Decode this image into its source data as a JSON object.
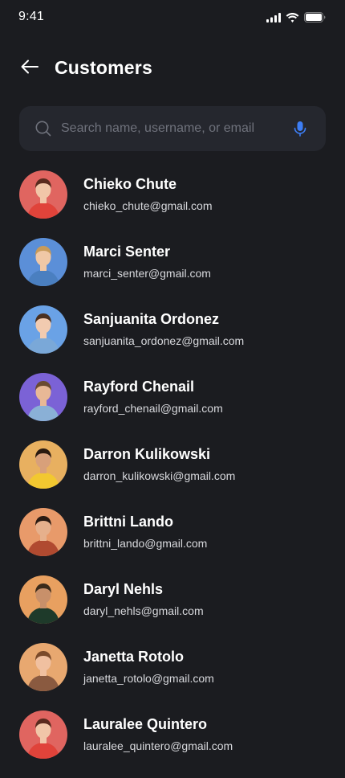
{
  "status_bar": {
    "time": "9:41"
  },
  "header": {
    "back_icon": "arrow-left-icon",
    "title": "Customers"
  },
  "search": {
    "placeholder": "Search name, username, or email",
    "value": "",
    "search_icon": "search-icon",
    "mic_icon": "microphone-icon",
    "mic_color": "#3d7ef5"
  },
  "colors": {
    "background": "#1b1c20",
    "search_bg": "#25272e",
    "accent": "#3d7ef5"
  },
  "customers": [
    {
      "name": "Chieko Chute",
      "email": "chieko_chute@gmail.com",
      "avatar_bg": "#e06560",
      "shirt": "#e0433a",
      "hair": "#5a2a1e",
      "skin": "#f1c6a8"
    },
    {
      "name": "Marci Senter",
      "email": "marci_senter@gmail.com",
      "avatar_bg": "#5b8fd8",
      "shirt": "#4a7fc0",
      "hair": "#c89b5a",
      "skin": "#f0c8a6"
    },
    {
      "name": "Sanjuanita Ordonez",
      "email": "sanjuanita_ordonez@gmail.com",
      "avatar_bg": "#6aa2e6",
      "shirt": "#7aa8d8",
      "hair": "#4a3020",
      "skin": "#f2cbb0"
    },
    {
      "name": "Rayford Chenail",
      "email": "rayford_chenail@gmail.com",
      "avatar_bg": "#7b62d6",
      "shirt": "#8ab0d6",
      "hair": "#6a4a30",
      "skin": "#e8b896"
    },
    {
      "name": "Darron Kulikowski",
      "email": "darron_kulikowski@gmail.com",
      "avatar_bg": "#e8b060",
      "shirt": "#f2c830",
      "hair": "#2a1a10",
      "skin": "#d8a07a"
    },
    {
      "name": "Brittni Lando",
      "email": "brittni_lando@gmail.com",
      "avatar_bg": "#e89a6a",
      "shirt": "#b04a30",
      "hair": "#2a1a12",
      "skin": "#e6b08c"
    },
    {
      "name": "Daryl Nehls",
      "email": "daryl_nehls@gmail.com",
      "avatar_bg": "#e8a060",
      "shirt": "#1e3a2a",
      "hair": "#3a2a1a",
      "skin": "#c8906a"
    },
    {
      "name": "Janetta Rotolo",
      "email": "janetta_rotolo@gmail.com",
      "avatar_bg": "#e8a870",
      "shirt": "#8a5a40",
      "hair": "#7a4a2a",
      "skin": "#f0c0a0"
    },
    {
      "name": "Lauralee Quintero",
      "email": "lauralee_quintero@gmail.com",
      "avatar_bg": "#e06560",
      "shirt": "#e0433a",
      "hair": "#5a2a1e",
      "skin": "#f1c6a8"
    }
  ]
}
